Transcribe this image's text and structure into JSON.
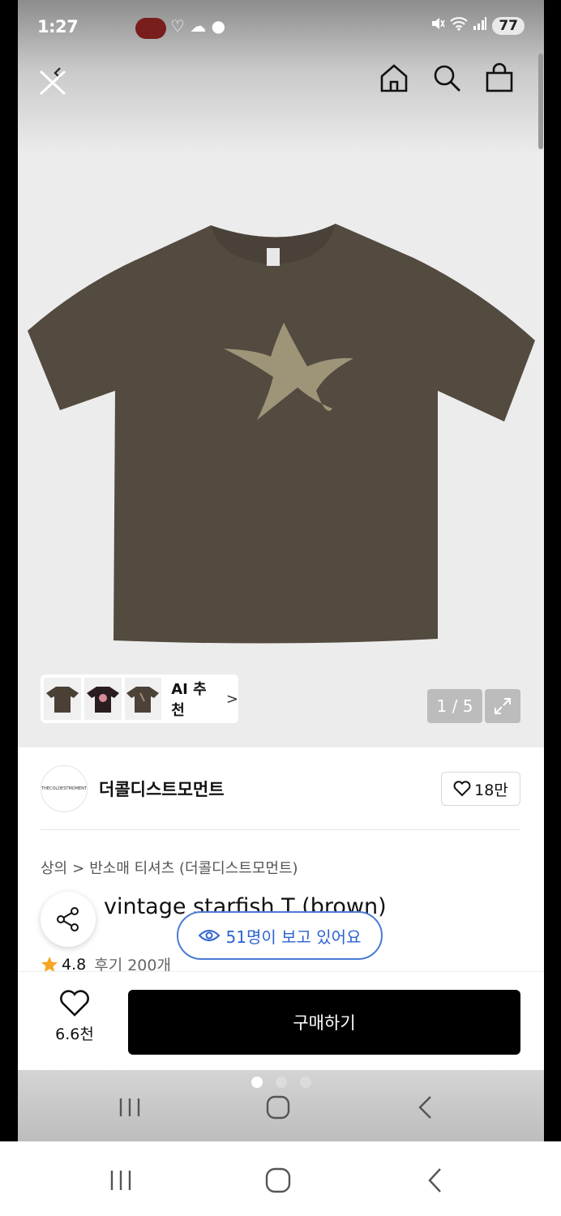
{
  "status_bar": {
    "time": "1:27",
    "battery": "77"
  },
  "top_nav": {
    "back_icon": "chevron-left-icon",
    "close_icon": "close-icon",
    "home_icon": "home-icon",
    "search_icon": "search-icon",
    "cart_icon": "bag-icon"
  },
  "product_image": {
    "ai_recommend_label": "AI 추천",
    "ai_recommend_chevron": ">",
    "counter": "1 / 5"
  },
  "brand": {
    "name": "더콜디스트모먼트",
    "logo_text": "THECOLDESTMOMENT",
    "follow_count": "18만"
  },
  "breadcrumb": {
    "items": [
      "상의",
      "반소매 티셔츠 (더콜디스트모먼트)"
    ],
    "separator": ">"
  },
  "product": {
    "title": "vintage starfish T (brown)",
    "viewers_text": "51명이 보고 있어요",
    "rating": "4.8",
    "reviews": "후기 200개"
  },
  "bottom_bar": {
    "like_count": "6.6천",
    "buy_label": "구매하기"
  },
  "colors": {
    "tee": "#534a40",
    "star": "#9e9579",
    "accent_blue": "#2c64cf",
    "star_rating": "#f5a623"
  }
}
